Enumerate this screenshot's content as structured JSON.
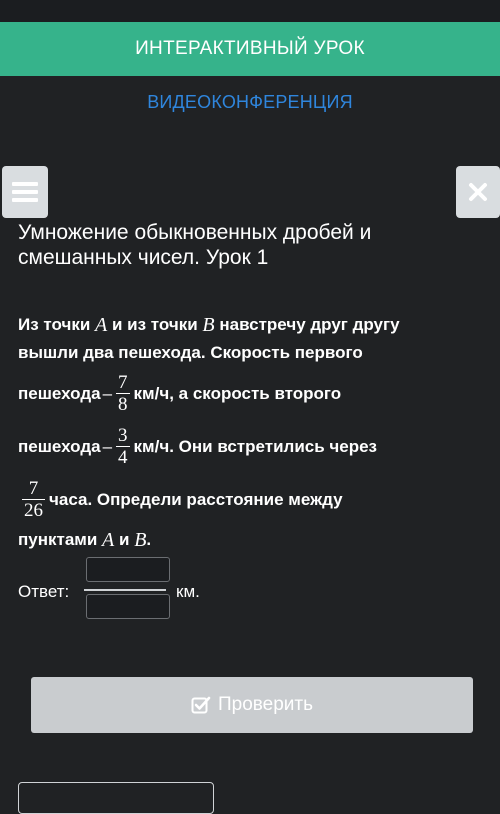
{
  "header": {
    "interactive_lesson": "ИНТЕРАКТИВНЫЙ УРОК",
    "videoconference": "ВИДЕОКОНФЕРЕНЦИЯ"
  },
  "icons": {
    "menu": "hamburger-icon",
    "close": "close-icon",
    "check": "checkbox-check-icon"
  },
  "colors": {
    "green": "#36b38b",
    "link": "#2f86dd",
    "background": "#202224",
    "button": "#c9cccf"
  },
  "lesson": {
    "title": "Умножение обыкновенных дробей и смешанных чисел. Урок 1"
  },
  "problem": {
    "p1": "Из точки",
    "A": "A",
    "p2": "и из точки",
    "B": "B",
    "p3": "навстречу друг другу",
    "p4": "вышли два пешехода. Скорость первого",
    "p5": "пешехода",
    "minus": "–",
    "f1_num": "7",
    "f1_den": "8",
    "p6": "км/ч, а скорость второго",
    "p7": "пешехода",
    "f2_num": "3",
    "f2_den": "4",
    "p8": "км/ч. Они встретились через",
    "f3_num": "7",
    "f3_den": "26",
    "p9": "часа. Определи расстояние между",
    "p10": "пунктами",
    "p11": "и",
    "dot": "."
  },
  "answer": {
    "label": "Ответ:",
    "unit": "км.",
    "numerator_value": "",
    "denominator_value": ""
  },
  "buttons": {
    "check": "Проверить"
  }
}
